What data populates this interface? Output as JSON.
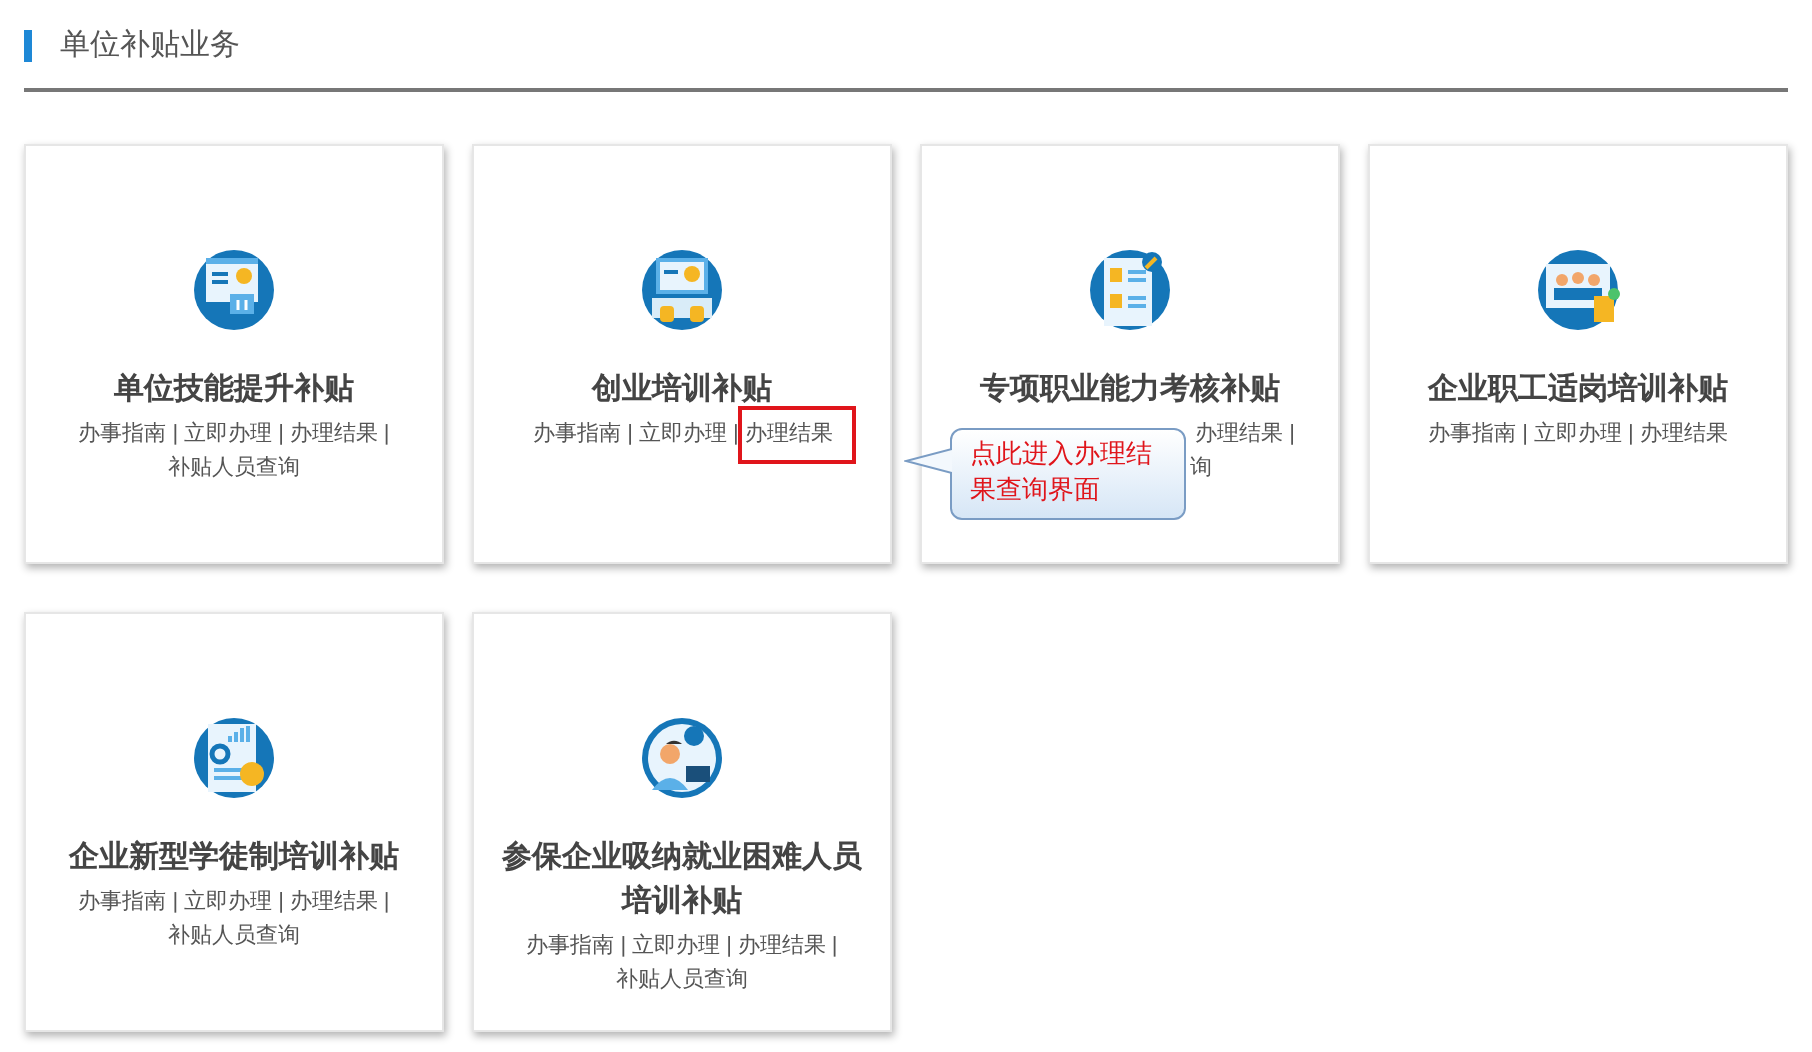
{
  "section_title": "单位补贴业务",
  "cards": [
    {
      "title": "单位技能提升补贴",
      "lines": [
        [
          {
            "kind": "link",
            "text": "办事指南",
            "highlighted": false
          },
          {
            "kind": "separator",
            "text": "|"
          },
          {
            "kind": "link",
            "text": "立即办理",
            "highlighted": false
          },
          {
            "kind": "separator",
            "text": "|"
          },
          {
            "kind": "link",
            "text": "办理结果",
            "highlighted": false
          },
          {
            "kind": "separator",
            "text": "|"
          }
        ],
        [
          {
            "kind": "link",
            "text": "补贴人员查询",
            "highlighted": false
          }
        ]
      ]
    },
    {
      "title": "创业培训补贴",
      "lines": [
        [
          {
            "kind": "link",
            "text": "办事指南",
            "highlighted": false
          },
          {
            "kind": "separator",
            "text": "|"
          },
          {
            "kind": "link",
            "text": "立即办理",
            "highlighted": false
          },
          {
            "kind": "separator",
            "text": "|"
          },
          {
            "kind": "link",
            "text": "办理结果",
            "highlighted": true
          }
        ]
      ]
    },
    {
      "title": "专项职业能力考核补贴",
      "lines": [
        [
          {
            "kind": "wide-gap"
          },
          {
            "kind": "link",
            "text": "办理结果",
            "highlighted": false
          },
          {
            "kind": "separator",
            "text": "|"
          }
        ],
        [
          {
            "kind": "narrow-gap"
          },
          {
            "kind": "link",
            "text": "询",
            "highlighted": false
          }
        ]
      ]
    },
    {
      "title": "企业职工适岗培训补贴",
      "lines": [
        [
          {
            "kind": "link",
            "text": "办事指南",
            "highlighted": false
          },
          {
            "kind": "separator",
            "text": "|"
          },
          {
            "kind": "link",
            "text": "立即办理",
            "highlighted": false
          },
          {
            "kind": "separator",
            "text": "|"
          },
          {
            "kind": "link",
            "text": "办理结果",
            "highlighted": false
          }
        ]
      ]
    },
    {
      "title": "企业新型学徒制培训补贴",
      "lines": [
        [
          {
            "kind": "link",
            "text": "办事指南",
            "highlighted": false
          },
          {
            "kind": "separator",
            "text": "|"
          },
          {
            "kind": "link",
            "text": "立即办理",
            "highlighted": false
          },
          {
            "kind": "separator",
            "text": "|"
          },
          {
            "kind": "link",
            "text": "办理结果",
            "highlighted": false
          },
          {
            "kind": "separator",
            "text": "|"
          }
        ],
        [
          {
            "kind": "link",
            "text": "补贴人员查询",
            "highlighted": false
          }
        ]
      ]
    },
    {
      "title": "参保企业吸纳就业困难人员培训补贴",
      "lines": [
        [
          {
            "kind": "link",
            "text": "办事指南",
            "highlighted": false
          },
          {
            "kind": "separator",
            "text": "|"
          },
          {
            "kind": "link",
            "text": "立即办理",
            "highlighted": false
          },
          {
            "kind": "separator",
            "text": "|"
          },
          {
            "kind": "link",
            "text": "办理结果",
            "highlighted": false
          },
          {
            "kind": "separator",
            "text": "|"
          }
        ],
        [
          {
            "kind": "link",
            "text": "补贴人员查询",
            "highlighted": false
          }
        ]
      ]
    }
  ],
  "callout": {
    "text": "点此进入办理结果查询界面"
  }
}
